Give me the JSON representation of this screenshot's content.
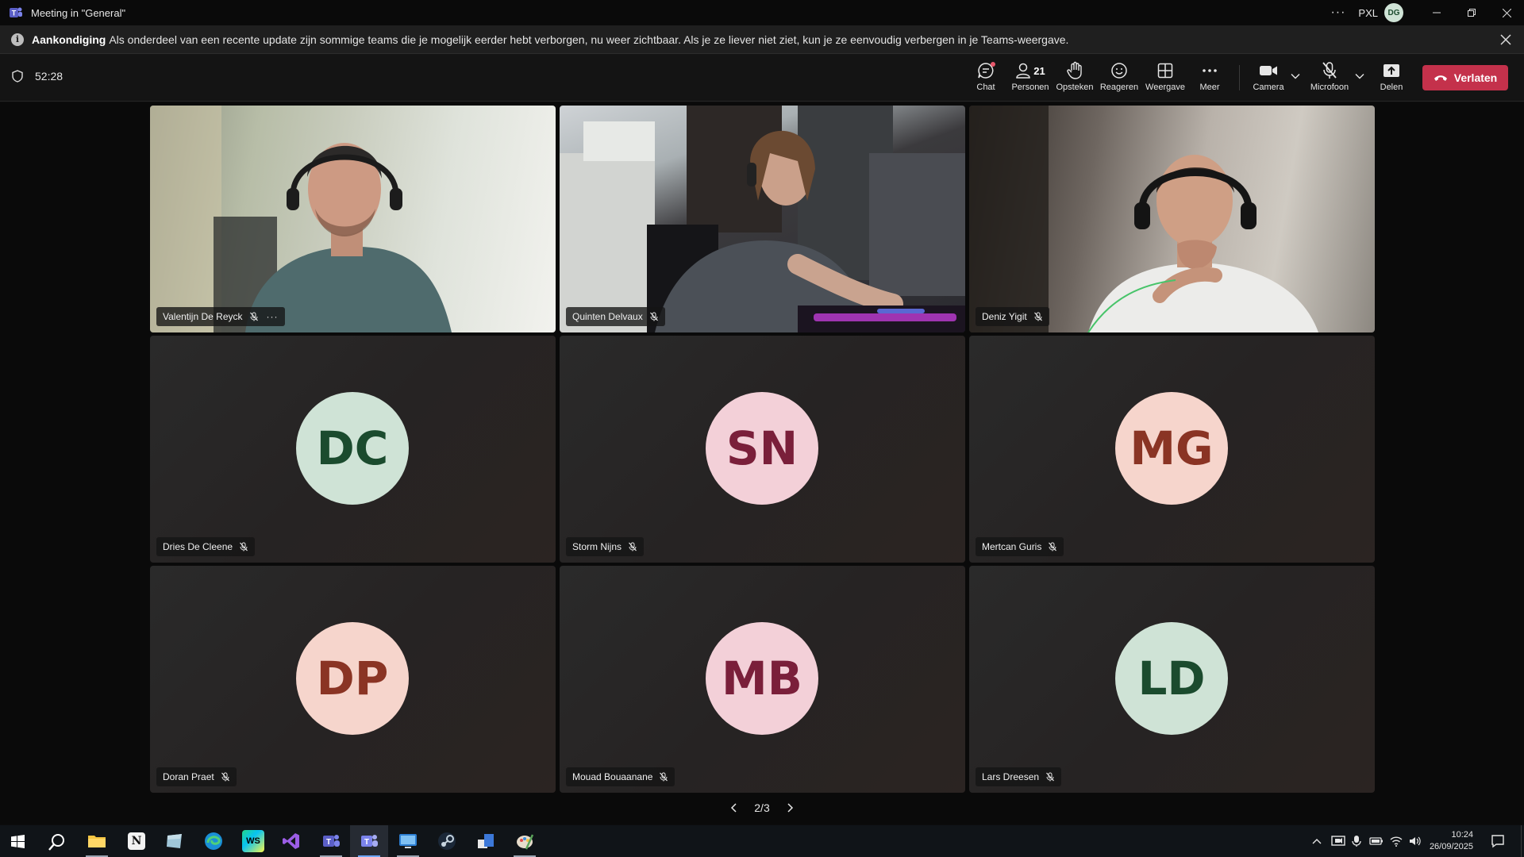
{
  "window": {
    "title": "Meeting in \"General\"",
    "org": "PXL",
    "user_initials": "DG"
  },
  "announcement": {
    "label": "Aankondiging",
    "message": "Als onderdeel van een recente update zijn sommige teams die je mogelijk eerder hebt verborgen, nu weer zichtbaar. Als je ze liever niet ziet, kun je ze eenvoudig verbergen in je Teams-weergave."
  },
  "toolbar": {
    "timer": "52:28",
    "chat_label": "Chat",
    "people_label": "Personen",
    "people_count": "21",
    "raise_label": "Opsteken",
    "react_label": "Reageren",
    "view_label": "Weergave",
    "more_label": "Meer",
    "camera_label": "Camera",
    "mic_label": "Microfoon",
    "share_label": "Delen",
    "leave_label": "Verlaten"
  },
  "participants": [
    {
      "name": "Valentijn De Reyck"
    },
    {
      "name": "Quinten Delvaux"
    },
    {
      "name": "Deniz Yigit"
    },
    {
      "name": "Dries De Cleene",
      "initials": "DC"
    },
    {
      "name": "Storm Nijns",
      "initials": "SN"
    },
    {
      "name": "Mertcan Guris",
      "initials": "MG"
    },
    {
      "name": "Doran Praet",
      "initials": "DP"
    },
    {
      "name": "Mouad Bouaanane",
      "initials": "MB"
    },
    {
      "name": "Lars Dreesen",
      "initials": "LD"
    }
  ],
  "pager": {
    "label": "2/3"
  },
  "taskbar": {
    "time": "10:24",
    "date": "26/09/2025"
  },
  "colors": {
    "leave": "#c4314b",
    "avatar_green_bg": "#cfe3d6",
    "avatar_green_fg": "#1b4b2e",
    "avatar_pink_bg": "#f3d0d8",
    "avatar_pink_fg": "#7a1f3a",
    "avatar_peach_bg": "#f6d5cc",
    "avatar_peach_fg": "#8a3424"
  }
}
